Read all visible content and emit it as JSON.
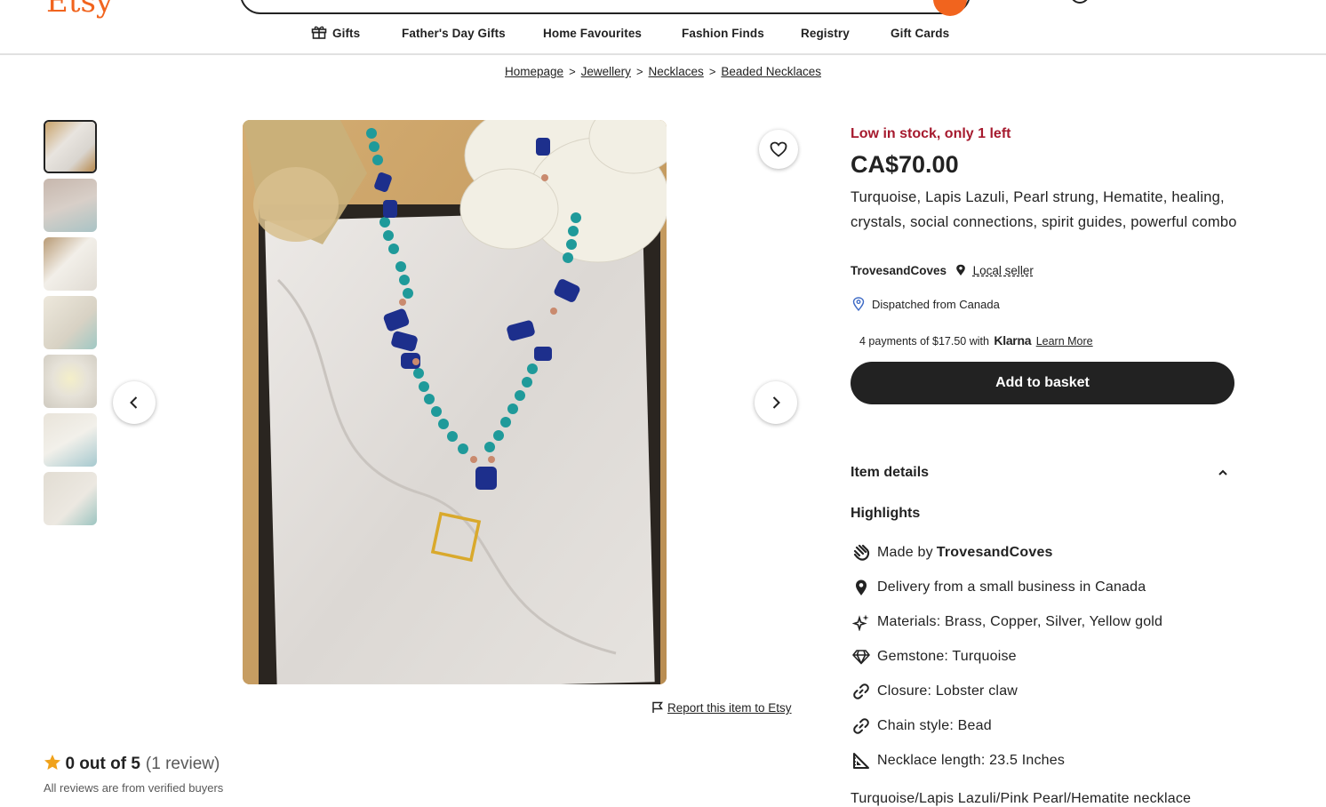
{
  "header": {
    "logo": "Etsy",
    "nav": [
      {
        "label": "Gifts"
      },
      {
        "label": "Father's Day Gifts"
      },
      {
        "label": "Home Favourites"
      },
      {
        "label": "Fashion Finds"
      },
      {
        "label": "Registry"
      },
      {
        "label": "Gift Cards"
      }
    ]
  },
  "breadcrumb": [
    "Homepage",
    "Jewellery",
    "Necklaces",
    "Beaded Necklaces"
  ],
  "gallery": {
    "thumbnail_count": 7,
    "report_label": "Report this item to Etsy"
  },
  "reviews": {
    "score": "0 out of 5",
    "count": "(1 review)",
    "note": "All reviews are from verified buyers"
  },
  "listing": {
    "stock": "Low in stock, only 1 left",
    "price": "CA$70.00",
    "title": "Turquoise, Lapis Lazuli, Pearl strung, Hematite, healing, crystals, social connections, spirit guides, powerful combo",
    "seller": "TrovesandCoves",
    "local_seller": "Local seller",
    "dispatch": "Dispatched from Canada",
    "klarna": {
      "text": "4 payments of $17.50 with",
      "brand": "Klarna",
      "learn_more": "Learn More"
    },
    "add_to_basket": "Add to basket"
  },
  "item_details": {
    "heading": "Item details",
    "highlights_heading": "Highlights",
    "highlights": [
      {
        "icon": "hand-icon",
        "text": "Made by",
        "bold": "TrovesandCoves"
      },
      {
        "icon": "pin-icon",
        "text": "Delivery from a small business in Canada",
        "bold": ""
      },
      {
        "icon": "sparkle-icon",
        "text": "Materials: Brass, Copper, Silver, Yellow gold",
        "bold": ""
      },
      {
        "icon": "gem-icon",
        "text": "Gemstone: Turquoise",
        "bold": ""
      },
      {
        "icon": "link-icon",
        "text": "Closure: Lobster claw",
        "bold": ""
      },
      {
        "icon": "link-icon",
        "text": "Chain style: Bead",
        "bold": ""
      },
      {
        "icon": "ruler-icon",
        "text": "Necklace length: 23.5 Inches",
        "bold": ""
      }
    ],
    "description_start": "Turquoise/Lapis Lazuli/Pink Pearl/Hematite necklace"
  },
  "colors": {
    "brand": "#f1641e",
    "stock_red": "#a61a2e",
    "button_dark": "#222222"
  }
}
